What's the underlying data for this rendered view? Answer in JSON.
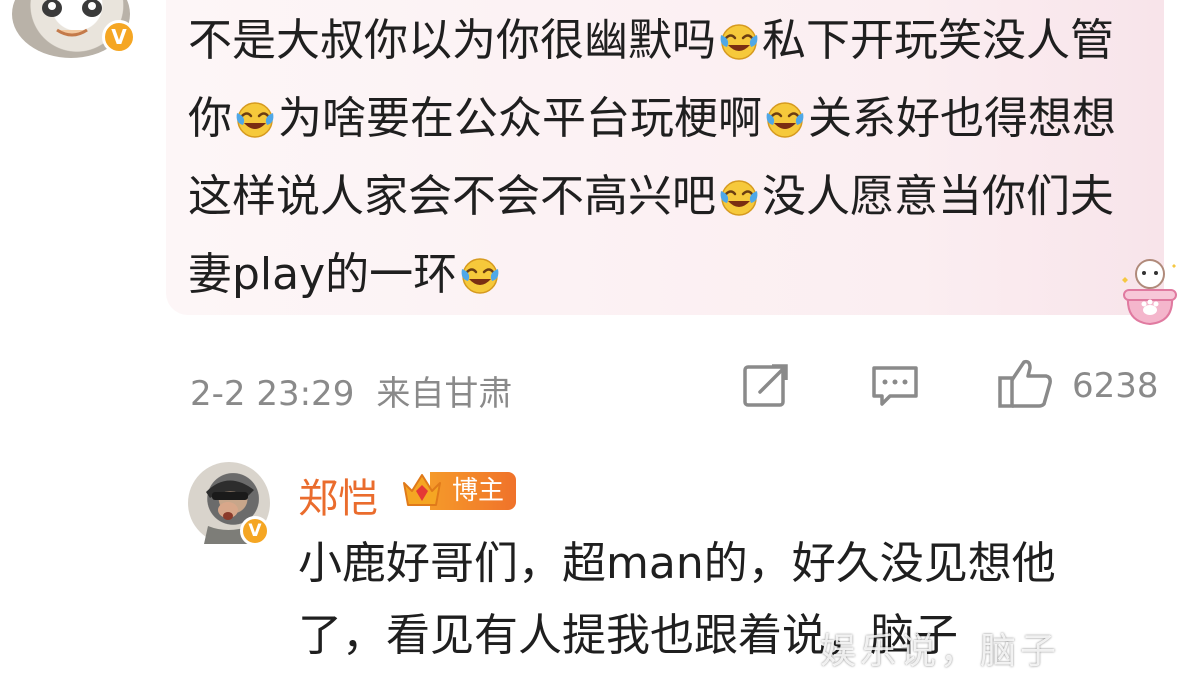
{
  "comment": {
    "author_avatar": "anime-avatar",
    "verified_badge": "V",
    "segments": [
      {
        "t": "text",
        "v": "不是大叔你以为你很幽默吗"
      },
      {
        "t": "emoji",
        "name": "laugh-cry-emoji"
      },
      {
        "t": "text",
        "v": "私下开玩笑没人管你"
      },
      {
        "t": "emoji",
        "name": "laugh-cry-emoji"
      },
      {
        "t": "text",
        "v": "为啥要在公众平台玩梗啊"
      },
      {
        "t": "emoji",
        "name": "laugh-cry-emoji"
      },
      {
        "t": "text",
        "v": "关系好也得想想这样说人家会不会不高兴吧"
      },
      {
        "t": "emoji",
        "name": "laugh-cry-emoji"
      },
      {
        "t": "text",
        "v": "没人愿意当你们夫妻play的一环"
      },
      {
        "t": "emoji",
        "name": "laugh-cry-emoji"
      }
    ],
    "time": "2-2 23:29",
    "location": "来自甘肃",
    "like_count": "6238"
  },
  "reply": {
    "name": "郑恺",
    "badge": "博主",
    "verified_badge": "V",
    "text": "小鹿好哥们，超man的，好久没见想他了，看见有人提我也跟着说，脑子"
  },
  "watermark": "娱乐说，脑子",
  "colors": {
    "bubble": "#fbeef1",
    "meta_gray": "#8a8a8a",
    "name_orange": "#ea6c2d",
    "badge_orange": "#f5a623"
  }
}
